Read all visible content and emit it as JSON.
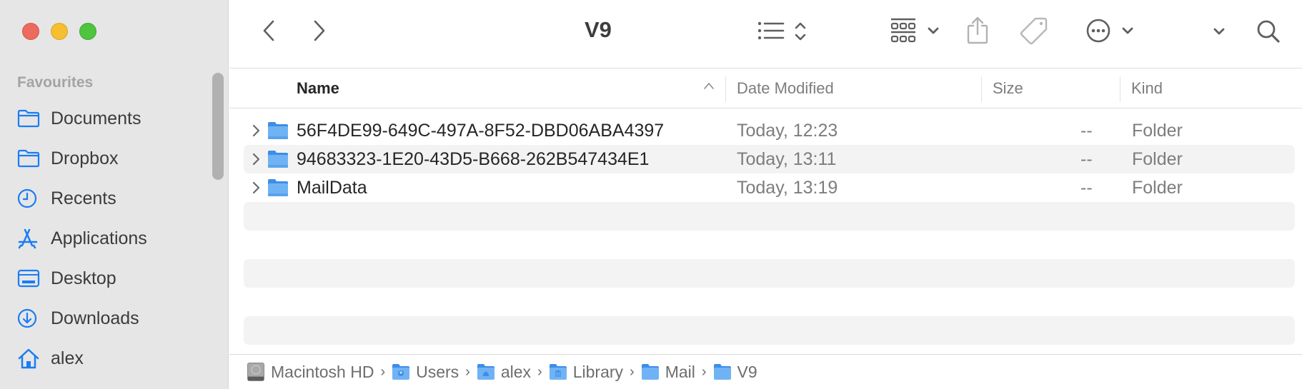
{
  "window": {
    "title": "V9",
    "controls": [
      "close",
      "minimize",
      "zoom"
    ]
  },
  "sidebar": {
    "section_label": "Favourites",
    "items": [
      {
        "label": "Documents",
        "icon": "folder-icon"
      },
      {
        "label": "Dropbox",
        "icon": "folder-icon"
      },
      {
        "label": "Recents",
        "icon": "clock-icon"
      },
      {
        "label": "Applications",
        "icon": "applications-icon"
      },
      {
        "label": "Desktop",
        "icon": "desktop-icon"
      },
      {
        "label": "Downloads",
        "icon": "download-icon"
      },
      {
        "label": "alex",
        "icon": "home-icon"
      }
    ],
    "accent_color": "#1a7cf5"
  },
  "toolbar": {
    "back_icon": "chevron-left-icon",
    "forward_icon": "chevron-right-icon",
    "view_icon": "list-view-icon",
    "group_icon": "grid-group-icon",
    "share_icon": "share-icon",
    "tag_icon": "tag-icon",
    "action_icon": "ellipsis-circle-icon",
    "search_icon": "search-icon"
  },
  "columns": {
    "name": "Name",
    "date": "Date Modified",
    "size": "Size",
    "kind": "Kind",
    "sorted_by": "Name",
    "sort_direction": "ascending"
  },
  "files": [
    {
      "name": "56F4DE99-649C-497A-8F52-DBD06ABA4397",
      "date": "Today, 12:23",
      "size": "--",
      "kind": "Folder"
    },
    {
      "name": "94683323-1E20-43D5-B668-262B547434E1",
      "date": "Today, 13:11",
      "size": "--",
      "kind": "Folder"
    },
    {
      "name": "MailData",
      "date": "Today, 13:19",
      "size": "--",
      "kind": "Folder"
    }
  ],
  "pathbar": [
    {
      "label": "Macintosh HD",
      "icon": "hard-drive-icon"
    },
    {
      "label": "Users",
      "icon": "users-folder-icon"
    },
    {
      "label": "alex",
      "icon": "home-folder-icon"
    },
    {
      "label": "Library",
      "icon": "library-folder-icon"
    },
    {
      "label": "Mail",
      "icon": "folder-icon"
    },
    {
      "label": "V9",
      "icon": "folder-icon"
    }
  ]
}
